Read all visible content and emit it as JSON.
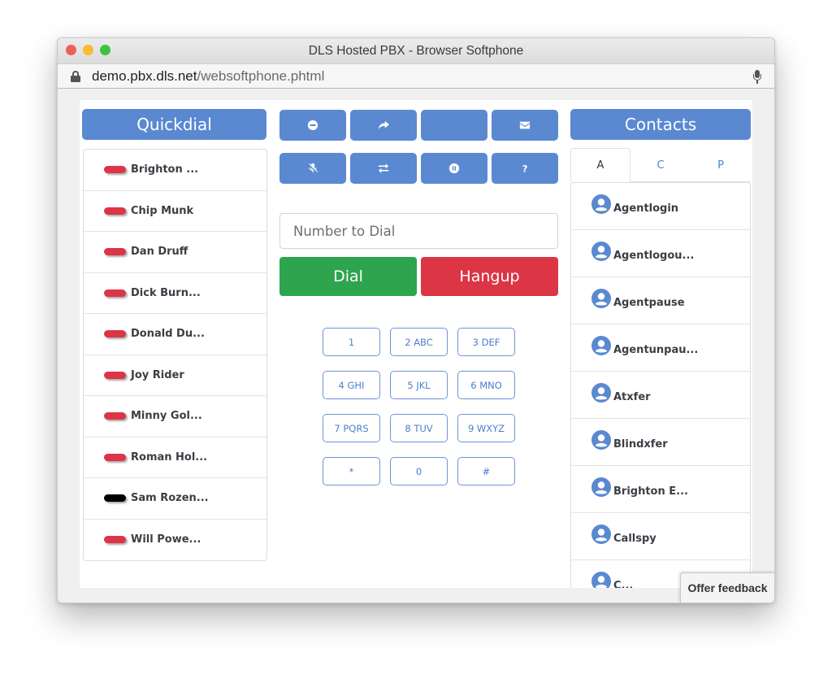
{
  "window": {
    "title": "DLS Hosted PBX - Browser Softphone",
    "url_host": "demo.pbx.dls.net",
    "url_path": "/websoftphone.phtml"
  },
  "colors": {
    "primary": "#5a89d2",
    "dial": "#2ea44f",
    "hangup": "#dc3545",
    "status_busy": "#dc3545",
    "status_offline": "#000000"
  },
  "quickdial": {
    "header": "Quickdial",
    "items": [
      {
        "name": "Brighton ...",
        "status": "busy"
      },
      {
        "name": "Chip Munk",
        "status": "busy"
      },
      {
        "name": "Dan Druff",
        "status": "busy"
      },
      {
        "name": "Dick Burn...",
        "status": "busy"
      },
      {
        "name": "Donald Du...",
        "status": "busy"
      },
      {
        "name": "Joy Rider",
        "status": "busy"
      },
      {
        "name": "Minny Gol...",
        "status": "busy"
      },
      {
        "name": "Roman Hol...",
        "status": "busy"
      },
      {
        "name": "Sam Rozen...",
        "status": "offline"
      },
      {
        "name": "Will Powe...",
        "status": "busy"
      }
    ]
  },
  "toolbar": {
    "buttons": [
      {
        "icon": "do-not-disturb-icon"
      },
      {
        "icon": "forward-icon"
      },
      {
        "icon": ""
      },
      {
        "icon": "envelope-icon"
      },
      {
        "icon": "mute-microphone-icon"
      },
      {
        "icon": "transfer-icon"
      },
      {
        "icon": "hold-pause-icon"
      },
      {
        "icon": "help-question-icon"
      }
    ]
  },
  "dialer": {
    "placeholder": "Number to Dial",
    "value": "",
    "dial_label": "Dial",
    "hangup_label": "Hangup",
    "keypad": [
      "1",
      "2 ABC",
      "3 DEF",
      "4 GHI",
      "5 JKL",
      "6 MNO",
      "7 PQRS",
      "8 TUV",
      "9 WXYZ",
      "*",
      "0",
      "#"
    ]
  },
  "contacts": {
    "header": "Contacts",
    "tabs": [
      {
        "label": "A",
        "active": true
      },
      {
        "label": "C",
        "active": false
      },
      {
        "label": "P",
        "active": false
      }
    ],
    "items": [
      "Agentlogin",
      "Agentlogou...",
      "Agentpause",
      "Agentunpau...",
      "Atxfer",
      "Blindxfer",
      "Brighton E...",
      "Callspy",
      "C..."
    ]
  },
  "feedback": {
    "label": "Offer feedback"
  }
}
